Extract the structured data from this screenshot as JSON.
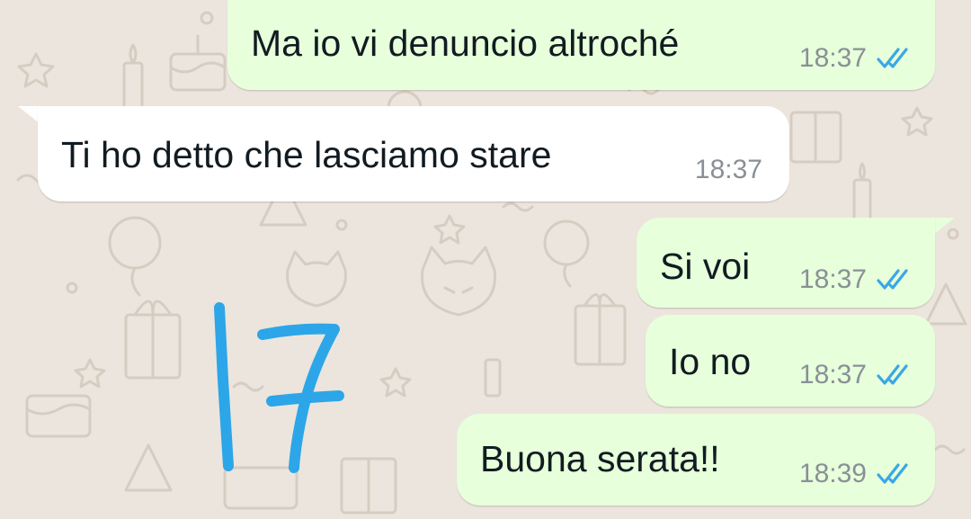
{
  "chat": {
    "messages": [
      {
        "direction": "outgoing",
        "text": "Ma io vi denuncio altroché",
        "time": "18:37",
        "status": "read"
      },
      {
        "direction": "incoming",
        "text": "Ti ho detto che lasciamo stare",
        "time": "18:37"
      },
      {
        "direction": "outgoing",
        "text": "Si voi",
        "time": "18:37",
        "status": "read"
      },
      {
        "direction": "outgoing",
        "text": "Io no",
        "time": "18:37",
        "status": "read"
      },
      {
        "direction": "outgoing",
        "text": "Buona serata!!",
        "time": "18:39",
        "status": "read"
      }
    ]
  },
  "annotation": {
    "text": "17",
    "color": "#2ca6e8"
  },
  "colors": {
    "wallpaper": "#ece5dd",
    "outgoing_bubble": "#e7ffdb",
    "incoming_bubble": "#ffffff",
    "read_ticks": "#3aa7e6",
    "timestamp": "#8a9096"
  },
  "icons": {
    "read_status": "double-check-icon"
  }
}
